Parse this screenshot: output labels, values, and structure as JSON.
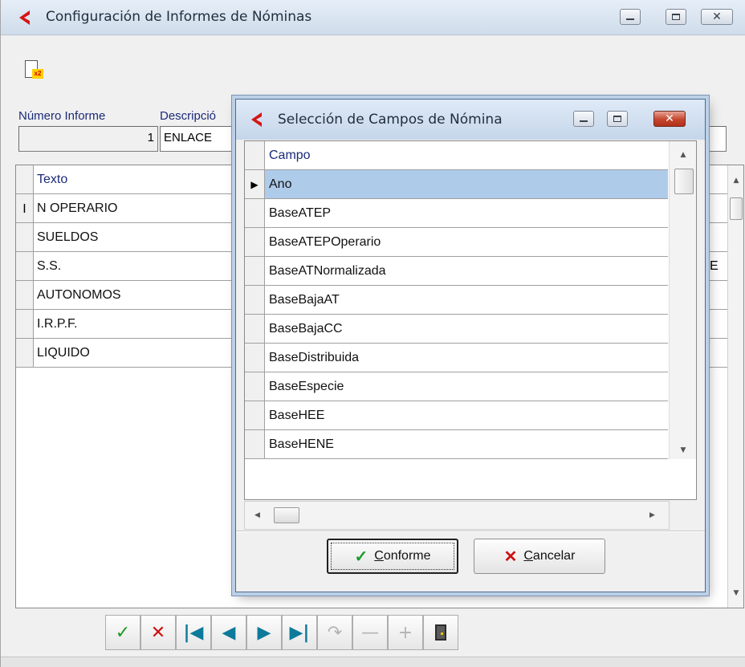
{
  "main_window": {
    "title": "Configuración de Informes de Nóminas",
    "numero_label": "Número Informe",
    "descripcion_label": "Descripció",
    "numero_value": "1",
    "descripcion_value": "ENLACE",
    "grid": {
      "header": "Texto",
      "rows": [
        "N OPERARIO",
        "SUELDOS",
        "S.S.",
        "AUTONOMOS",
        "I.R.P.F.",
        "LIQUIDO"
      ],
      "edit_marker": "I",
      "partial_text": "E"
    },
    "navigator": {
      "buttons": [
        "post",
        "cancel",
        "first",
        "prior",
        "next",
        "last",
        "refresh",
        "delete",
        "insert",
        "exit"
      ]
    }
  },
  "dialog": {
    "title": "Selección de Campos de Nómina",
    "grid": {
      "header": "Campo",
      "rows": [
        "Ano",
        "BaseATEP",
        "BaseATEPOperario",
        "BaseATNormalizada",
        "BaseBajaAT",
        "BaseBajaCC",
        "BaseDistribuida",
        "BaseEspecie",
        "BaseHEE",
        "BaseHENE"
      ],
      "selected_index": 0
    },
    "ok_button": {
      "accel": "C",
      "rest": "onforme"
    },
    "cancel_button": {
      "accel": "C",
      "rest": "ancelar"
    }
  },
  "colors": {
    "selection": "#aecbea",
    "accept_green": "#1b9a26",
    "cancel_red": "#cc1010",
    "nav_teal": "#0d7a9a",
    "label_blue": "#1b2a78"
  },
  "icons": [
    "app-logo-icon",
    "new-document-icon",
    "minimize-icon",
    "maximize-icon",
    "close-icon",
    "row-pointer-icon",
    "check-icon",
    "cross-icon",
    "door-exit-icon"
  ]
}
